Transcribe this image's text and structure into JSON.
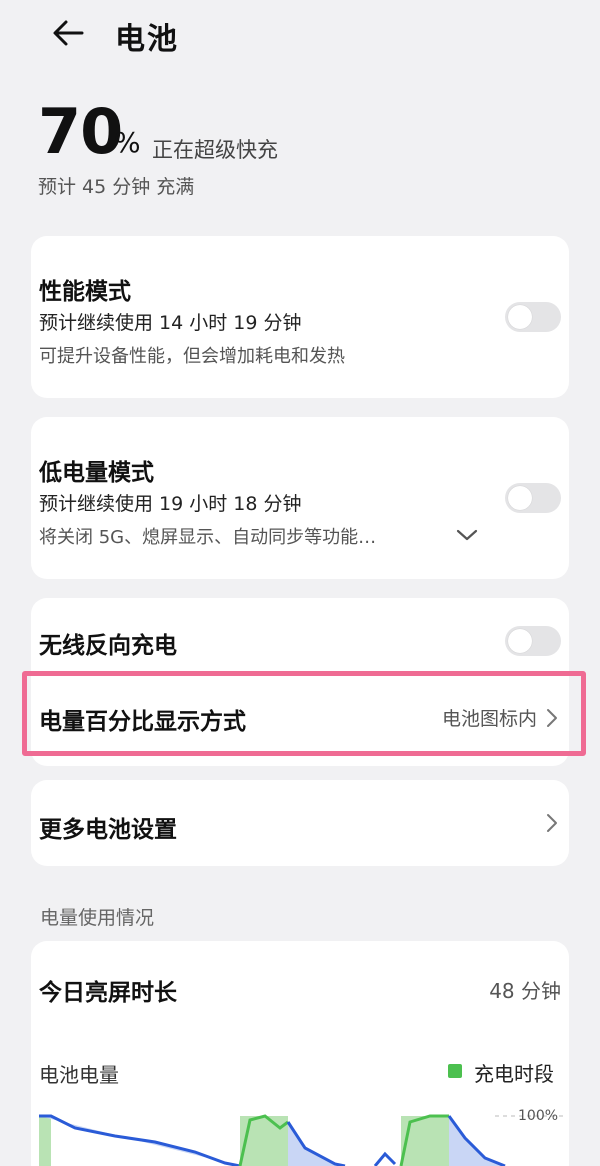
{
  "header": {
    "title": "电池",
    "back_icon": "back-arrow-icon"
  },
  "battery": {
    "percent": "70",
    "unit": "%",
    "status": "正在超级快充",
    "estimate": "预计 45 分钟 充满"
  },
  "performance_mode": {
    "title": "性能模式",
    "subtitle": "预计继续使用 14 小时 19 分钟",
    "note": "可提升设备性能，但会增加耗电和发热",
    "enabled": false
  },
  "low_power_mode": {
    "title": "低电量模式",
    "subtitle": "预计继续使用 19 小时 18 分钟",
    "note": "将关闭 5G、熄屏显示、自动同步等功能…",
    "enabled": false
  },
  "wireless_reverse": {
    "title": "无线反向充电",
    "enabled": false
  },
  "percent_display": {
    "title": "电量百分比显示方式",
    "value": "电池图标内"
  },
  "more_settings": {
    "title": "更多电池设置"
  },
  "usage": {
    "section_label": "电量使用情况",
    "screen_time_label": "今日亮屏时长",
    "screen_time_value": "48 分钟",
    "battery_level_label": "电池电量",
    "legend_charging": "充电时段",
    "axis_max": "100%"
  },
  "colors": {
    "accent_highlight": "#ef6b93",
    "charging_green": "#4cc04f",
    "line_blue": "#2a5bd7",
    "fill_blue": "#c9d6f5"
  }
}
